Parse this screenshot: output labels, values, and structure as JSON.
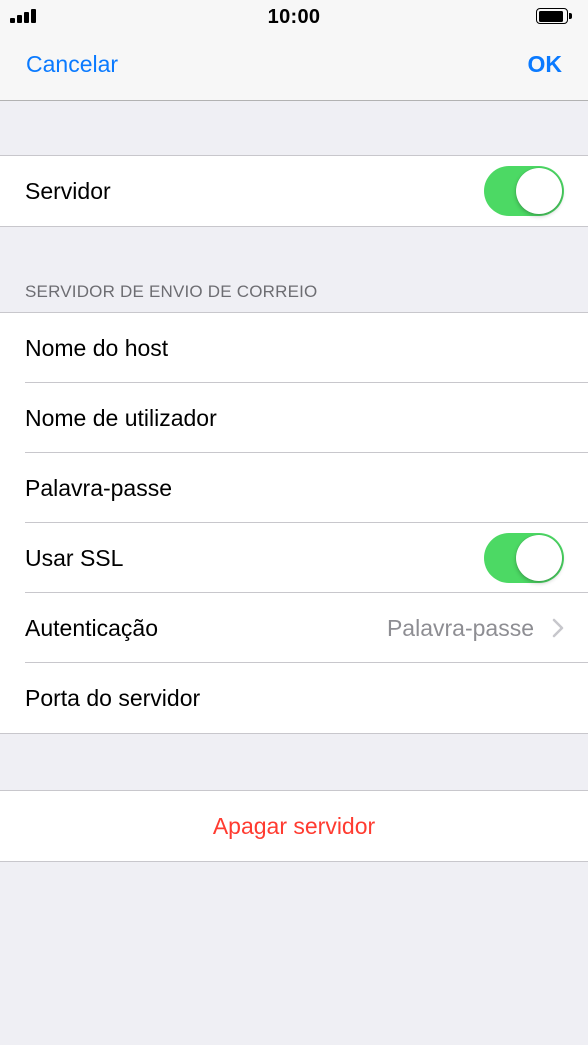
{
  "status_bar": {
    "time": "10:00",
    "signal_icon": "signal-bars-icon",
    "battery_icon": "battery-full-icon"
  },
  "nav": {
    "cancel_label": "Cancelar",
    "ok_label": "OK"
  },
  "server_row": {
    "label": "Servidor",
    "toggle_on": true
  },
  "outgoing_section": {
    "header": "SERVIDOR DE ENVIO DE CORREIO",
    "rows": [
      {
        "label": "Nome do host"
      },
      {
        "label": "Nome de utilizador"
      },
      {
        "label": "Palavra-passe"
      },
      {
        "label": "Usar SSL",
        "toggle_on": true
      },
      {
        "label": "Autenticação",
        "detail": "Palavra-passe",
        "icon": "chevron-right-icon"
      },
      {
        "label": "Porta do servidor"
      }
    ]
  },
  "delete_button": {
    "label": "Apagar servidor"
  },
  "colors": {
    "accent": "#0a7aff",
    "toggle_on": "#4cd964",
    "destructive": "#ff3b30",
    "background": "#efeff4"
  }
}
